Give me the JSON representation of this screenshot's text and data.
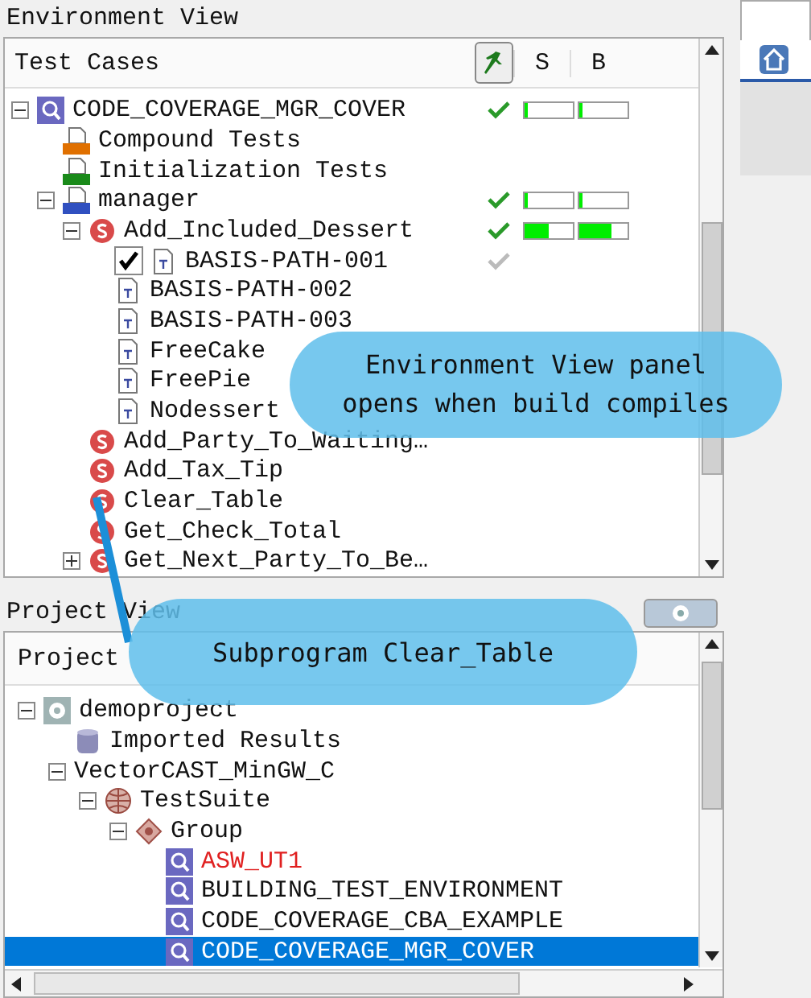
{
  "environment_view": {
    "title": "Environment View",
    "columns": [
      {
        "label": "Test Cases"
      },
      {
        "label": "S"
      },
      {
        "label": "B"
      }
    ],
    "tree": [
      {
        "label": "CODE_COVERAGE_MGR_COVER",
        "kind": "environment",
        "expanded": true,
        "check": {
          "color": "#2a9a2a"
        },
        "coverage": [
          {
            "level": 0.06
          },
          {
            "level": 0.06
          }
        ],
        "children": [
          {
            "label": "Compound Tests",
            "kind": "compound"
          },
          {
            "label": "Initialization Tests",
            "kind": "init"
          },
          {
            "label": "manager",
            "kind": "unit",
            "expanded": true,
            "check": {
              "color": "#2a9a2a"
            },
            "coverage": [
              {
                "level": 0.06
              },
              {
                "level": 0.06
              }
            ],
            "children": [
              {
                "label": "Add_Included_Dessert",
                "kind": "subprogram",
                "expanded": true,
                "check": {
                  "color": "#2a9a2a"
                },
                "coverage": [
                  {
                    "level": 0.5
                  },
                  {
                    "level": 0.65
                  }
                ],
                "children": [
                  {
                    "label": "BASIS-PATH-001",
                    "kind": "testcase",
                    "checked": true,
                    "check": {
                      "color": "#bbbbbb"
                    }
                  },
                  {
                    "label": "BASIS-PATH-002",
                    "kind": "testcase"
                  },
                  {
                    "label": "BASIS-PATH-003",
                    "kind": "testcase"
                  },
                  {
                    "label": "FreeCake",
                    "kind": "testcase"
                  },
                  {
                    "label": "FreePie",
                    "kind": "testcase"
                  },
                  {
                    "label": "Nodessert",
                    "kind": "testcase"
                  }
                ]
              },
              {
                "label": "Add_Party_To_Waiting…",
                "kind": "subprogram"
              },
              {
                "label": "Add_Tax_Tip",
                "kind": "subprogram"
              },
              {
                "label": "Clear_Table",
                "kind": "subprogram"
              },
              {
                "label": "Get_Check_Total",
                "kind": "subprogram"
              },
              {
                "label": "Get_Next_Party_To_Be…",
                "kind": "subprogram",
                "expanded": false
              }
            ]
          }
        ]
      }
    ]
  },
  "project_view": {
    "title": "Project View",
    "column": "Project",
    "tree": [
      {
        "label": "demoproject",
        "kind": "gear",
        "expanded": true,
        "children": [
          {
            "label": "Imported Results",
            "kind": "database"
          },
          {
            "label": "VectorCAST_MinGW_C",
            "kind": "plain",
            "expanded": true,
            "children": [
              {
                "label": "TestSuite",
                "kind": "globe",
                "expanded": true,
                "children": [
                  {
                    "label": "Group",
                    "kind": "group",
                    "expanded": true,
                    "children": [
                      {
                        "label": "ASW_UT1",
                        "kind": "environment",
                        "error": true,
                        "selected": false
                      },
                      {
                        "label": "BUILDING_TEST_ENVIRONMENT",
                        "kind": "environment",
                        "error": false,
                        "selected": false
                      },
                      {
                        "label": "CODE_COVERAGE_CBA_EXAMPLE",
                        "kind": "environment",
                        "error": false,
                        "selected": false
                      },
                      {
                        "label": "CODE_COVERAGE_MGR_COVER",
                        "kind": "environment",
                        "error": false,
                        "selected": true
                      }
                    ]
                  }
                ]
              }
            ]
          }
        ]
      }
    ]
  },
  "callouts": [
    {
      "text": "Environment View panel\nopens when build compiles"
    },
    {
      "text": "Subprogram Clear_Table"
    }
  ]
}
